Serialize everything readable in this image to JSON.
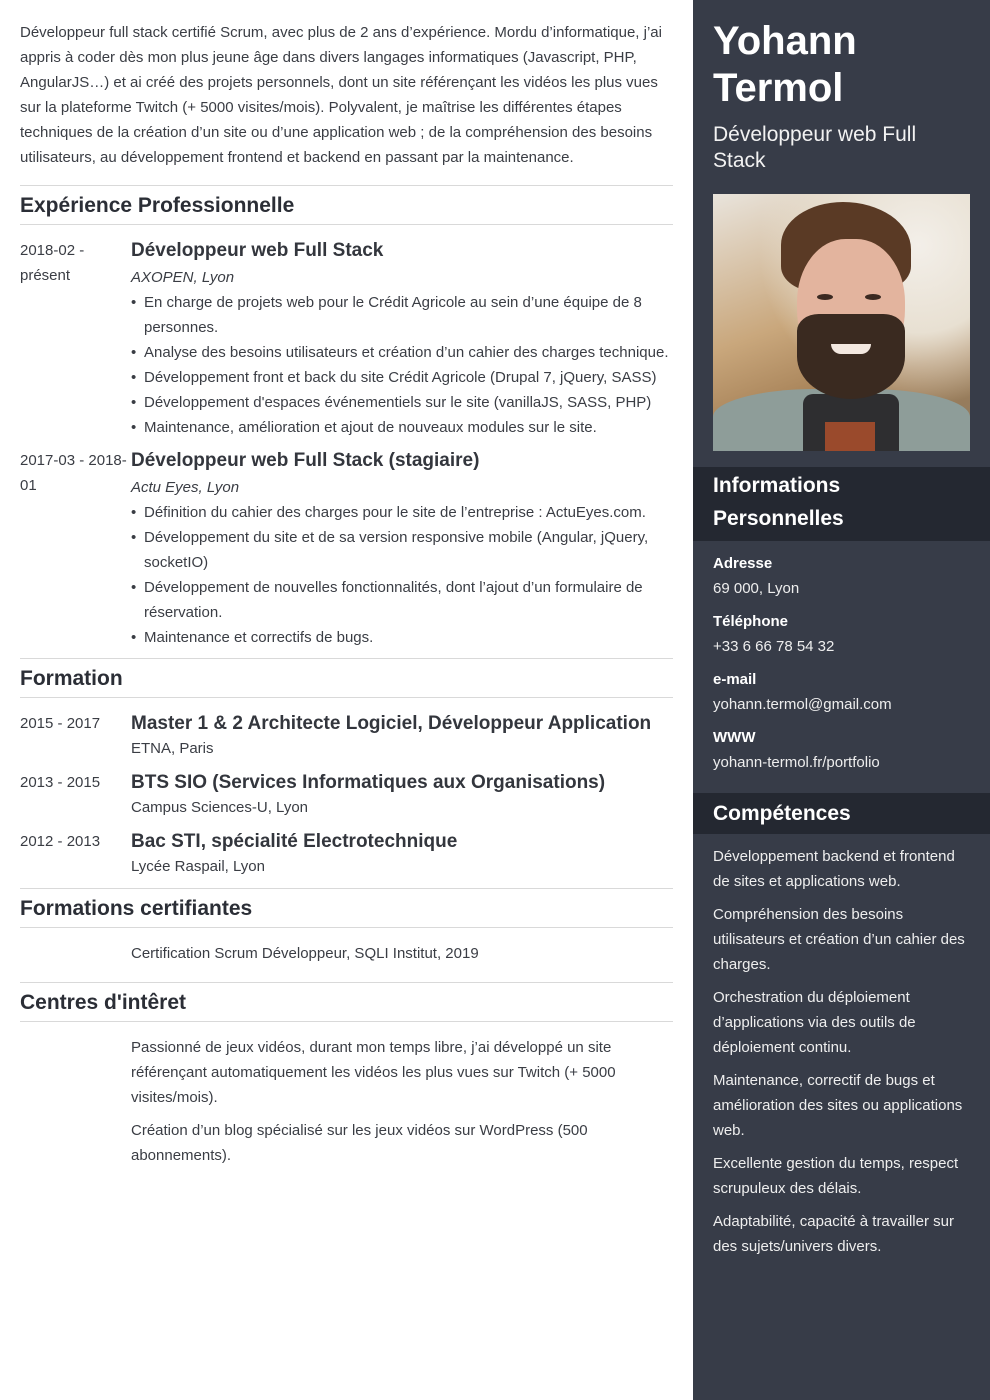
{
  "summary": "Développeur full stack certifié Scrum, avec plus de 2 ans d’expérience. Mordu d’informatique, j’ai appris à coder dès mon plus jeune âge dans divers langages informatiques (Javascript, PHP, AngularJS…) et ai créé des projets personnels, dont un site référençant les vidéos les plus vues sur la plateforme Twitch (+ 5000 visites/mois). Polyvalent, je maîtrise les différentes étapes techniques de la création d’un site ou d’une application web ; de la compréhension des besoins utilisateurs, au développement frontend et backend en passant par la maintenance.",
  "experience": {
    "title": "Expérience Professionnelle",
    "entries": [
      {
        "date": "2018-02 - présent",
        "title": "Développeur web Full Stack",
        "company": "AXOPEN, Lyon",
        "bullets": [
          "En charge de projets web pour le Crédit Agricole au sein d’une équipe de 8 personnes.",
          "Analyse des besoins utilisateurs et création d’un cahier des charges technique.",
          "Développement front et back du site Crédit Agricole (Drupal 7, jQuery, SASS)",
          "Développement d'espaces événementiels sur le site (vanillaJS, SASS, PHP)",
          "Maintenance, amélioration et ajout de nouveaux modules sur le site."
        ]
      },
      {
        "date": "2017-03 - 2018-01",
        "title": "Développeur web Full Stack (stagiaire)",
        "company": "Actu Eyes, Lyon",
        "bullets": [
          "Définition du cahier des charges pour le site de l’entreprise : ActuEyes.com.",
          "Développement du site et de sa version responsive mobile (Angular, jQuery, socketIO)",
          "Développement de nouvelles fonctionnalités, dont l’ajout d’un formulaire de réservation.",
          "Maintenance et correctifs de bugs."
        ]
      }
    ]
  },
  "education": {
    "title": "Formation",
    "entries": [
      {
        "date": "2015 - 2017",
        "title": "Master 1 & 2 Architecte Logiciel, Développeur Application",
        "place": "ETNA, Paris"
      },
      {
        "date": "2013 - 2015",
        "title": "BTS SIO (Services Informatiques aux Organisations)",
        "place": "Campus Sciences-U, Lyon"
      },
      {
        "date": "2012 - 2013",
        "title": "Bac STI, spécialité Electrotechnique",
        "place": "Lycée Raspail, Lyon"
      }
    ]
  },
  "certifications": {
    "title": "Formations certifiantes",
    "items": [
      "Certification Scrum Développeur, SQLI Institut, 2019"
    ]
  },
  "interests": {
    "title": "Centres d'intêret",
    "items": [
      "Passionné de jeux vidéos, durant mon temps libre, j’ai développé un site référençant automatiquement les vidéos les plus vues sur Twitch (+ 5000 visites/mois).",
      "Création d’un blog spécialisé sur les jeux vidéos sur WordPress (500 abonnements)."
    ]
  },
  "sidebar": {
    "name": "Yohann Termol",
    "job_title": "Développeur web Full Stack",
    "photo_alt": "profile-photo",
    "personal_info": {
      "title": "Informations Personnelles",
      "fields": [
        {
          "label": "Adresse",
          "value": "69 000, Lyon"
        },
        {
          "label": "Téléphone",
          "value": "+33 6 66 78 54 32"
        },
        {
          "label": "e-mail",
          "value": "yohann.termol@gmail.com"
        },
        {
          "label": "WWW",
          "value": "yohann-termol.fr/portfolio"
        }
      ]
    },
    "skills": {
      "title": "Compétences",
      "items": [
        "Développement backend et frontend de sites et applications web.",
        "Compréhension des besoins utilisateurs et création d’un cahier des charges.",
        "Orchestration du déploiement d’applications via des outils de déploiement continu.",
        "Maintenance, correctif de bugs et amélioration des sites ou applications web.",
        "Excellente gestion du temps, respect scrupuleux des délais.",
        "Adaptabilité, capacité à travailler sur des sujets/univers divers."
      ]
    }
  },
  "colors": {
    "sidebar_bg": "#373c48",
    "sidebar_header_bg": "#242831",
    "text": "#3a3d44",
    "divider": "#d9d9d9"
  }
}
